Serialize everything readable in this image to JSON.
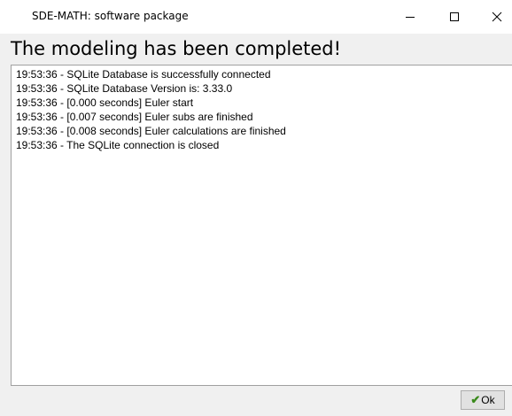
{
  "window": {
    "title": "SDE-MATH: software package"
  },
  "heading": "The modeling has been completed!",
  "log": {
    "lines": [
      "19:53:36 - SQLite Database is successfully connected",
      "19:53:36 - SQLite Database Version is: 3.33.0",
      "19:53:36 - [0.000 seconds] Euler start",
      "19:53:36 - [0.007 seconds] Euler subs are finished",
      "19:53:36 - [0.008 seconds] Euler calculations are finished",
      "19:53:36 - The SQLite connection is closed"
    ]
  },
  "ok_button": {
    "label": "Ok",
    "icon": "checkmark-icon",
    "check_glyph": "✔"
  },
  "colors": {
    "window_bg": "#f0f0f0",
    "titlebar_bg": "#ffffff",
    "log_border": "#a0a0a0",
    "check_green": "#3a8a1c"
  },
  "titlebar_icons": [
    "minimize-icon",
    "maximize-icon",
    "close-icon"
  ]
}
